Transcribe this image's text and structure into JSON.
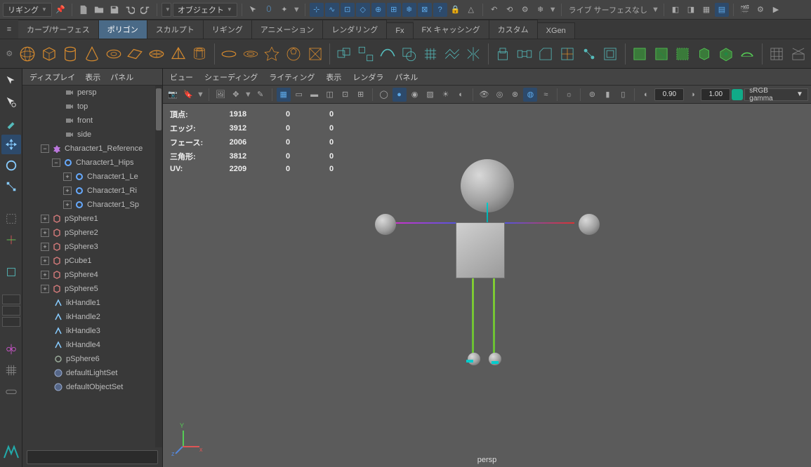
{
  "menubar": {
    "workspace": "リギング",
    "mode_label": "オブジェクト",
    "live_label": "ライブ サーフェスなし"
  },
  "shelf": {
    "tabs": [
      "カーブ/サーフェス",
      "ポリゴン",
      "スカルプト",
      "リギング",
      "アニメーション",
      "レンダリング",
      "Fx",
      "FX キャッシング",
      "カスタム",
      "XGen"
    ],
    "active": 1
  },
  "outliner": {
    "menus": [
      "ディスプレイ",
      "表示",
      "パネル"
    ],
    "cams": [
      "persp",
      "top",
      "front",
      "side"
    ],
    "nodes": {
      "ref": "Character1_Reference",
      "hips": "Character1_Hips",
      "le": "Character1_Le",
      "ri": "Character1_Ri",
      "sp": "Character1_Sp",
      "items": [
        "pSphere1",
        "pSphere2",
        "pSphere3",
        "pCube1",
        "pSphere4",
        "pSphere5",
        "ikHandle1",
        "ikHandle2",
        "ikHandle3",
        "ikHandle4",
        "pSphere6",
        "defaultLightSet",
        "defaultObjectSet"
      ]
    }
  },
  "viewport": {
    "menus": [
      "ビュー",
      "シェーディング",
      "ライティング",
      "表示",
      "レンダラ",
      "パネル"
    ],
    "near": "0.90",
    "far": "1.00",
    "colorspace": "sRGB gamma",
    "camera": "persp",
    "axis": {
      "x": "x",
      "y": "Y",
      "z": "z"
    }
  },
  "hud": {
    "rows": [
      {
        "label": "頂点:",
        "a": "1918",
        "b": "0",
        "c": "0"
      },
      {
        "label": "エッジ:",
        "a": "3912",
        "b": "0",
        "c": "0"
      },
      {
        "label": "フェース:",
        "a": "2006",
        "b": "0",
        "c": "0"
      },
      {
        "label": "三角形:",
        "a": "3812",
        "b": "0",
        "c": "0"
      },
      {
        "label": "UV:",
        "a": "2209",
        "b": "0",
        "c": "0"
      }
    ]
  }
}
